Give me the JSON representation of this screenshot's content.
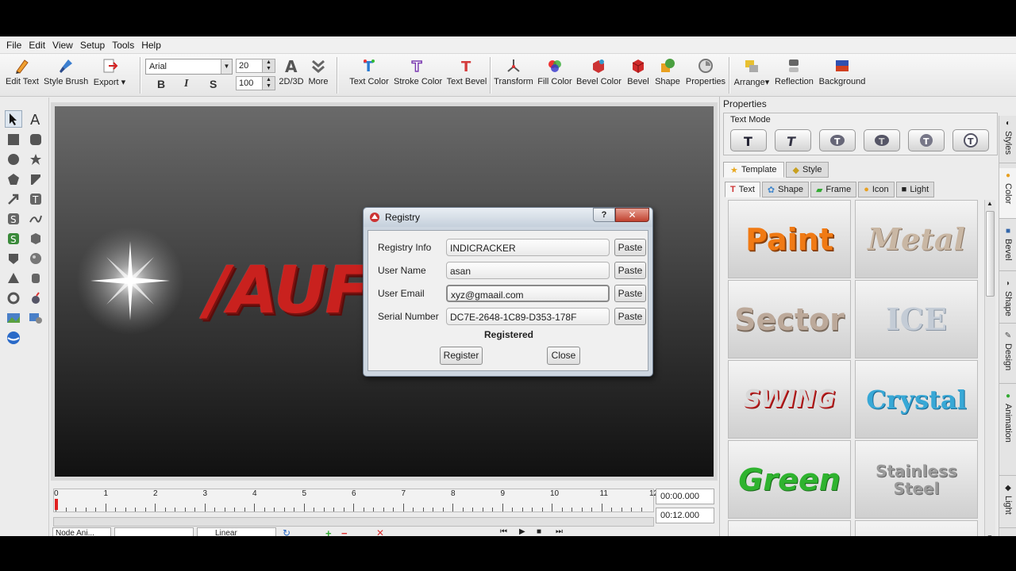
{
  "menu": [
    "File",
    "Edit",
    "View",
    "Setup",
    "Tools",
    "Help"
  ],
  "toolbar": {
    "left_buttons": [
      {
        "label": "Edit Text",
        "icon": "edit-text-icon"
      },
      {
        "label": "Style Brush",
        "icon": "style-brush-icon"
      },
      {
        "label": "Export",
        "icon": "export-icon"
      }
    ],
    "font_name": "Arial",
    "font_size": "20",
    "zoom": "100",
    "mode_2d3d": "2D/3D",
    "more": "More",
    "bold": "B",
    "italic": "I",
    "shadow": "S",
    "right_buttons": [
      {
        "label": "Text Color"
      },
      {
        "label": "Stroke Color"
      },
      {
        "label": "Text Bevel"
      },
      {
        "label": "Transform"
      },
      {
        "label": "Fill Color"
      },
      {
        "label": "Bevel Color"
      },
      {
        "label": "Bevel"
      },
      {
        "label": "Shape"
      },
      {
        "label": "Properties"
      },
      {
        "label": "Arrange"
      },
      {
        "label": "Reflection"
      },
      {
        "label": "Background"
      }
    ]
  },
  "canvas": {
    "text": "/AUF"
  },
  "timeline": {
    "ticks": [
      "0",
      "1",
      "2",
      "3",
      "4",
      "5",
      "6",
      "7",
      "8",
      "9",
      "10",
      "11",
      "12"
    ],
    "current_time": "00:00.000",
    "total_time": "00:12.000",
    "node_anim": "Node Ani...",
    "easing": "Linear"
  },
  "properties_panel": {
    "title": "Properties",
    "text_mode_label": "Text Mode",
    "tabs": [
      "Template",
      "Style"
    ],
    "subtabs": [
      "Text",
      "Shape",
      "Frame",
      "Icon",
      "Light"
    ],
    "templates": [
      {
        "label": "Paint",
        "color": "#f07a14"
      },
      {
        "label": "Metal",
        "color": "#c9b7a4"
      },
      {
        "label": "Sector",
        "color": "#bca99a"
      },
      {
        "label": "ICE",
        "color": "#c4ccd6"
      },
      {
        "label": "SWING",
        "color": "#d8d8d8"
      },
      {
        "label": "Crystal",
        "color": "#38a8d6"
      },
      {
        "label": "Green",
        "color": "#2fb32f"
      },
      {
        "label": "Stainless Steel",
        "color": "#9a9a9a"
      }
    ],
    "side_tabs": [
      "Styles",
      "Color",
      "Bevel",
      "Shape",
      "Design",
      "Animation",
      "Light"
    ]
  },
  "dialog": {
    "title": "Registry",
    "help": "?",
    "close_x": "✕",
    "fields": [
      {
        "label": "Registry Info",
        "value": "INDICRACKER",
        "button": "Paste"
      },
      {
        "label": "User Name",
        "value": "asan",
        "button": "Paste"
      },
      {
        "label": "User Email",
        "value": "xyz@gmaail.com",
        "button": "Paste"
      },
      {
        "label": "Serial Number",
        "value": "DC7E-2648-1C89-D353-178F",
        "button": "Paste"
      }
    ],
    "status": "Registered",
    "register_button": "Register",
    "close_button": "Close"
  }
}
